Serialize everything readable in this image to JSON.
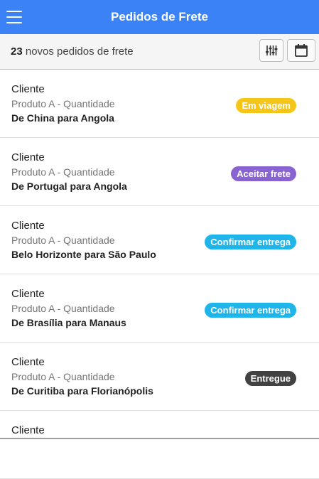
{
  "header": {
    "title": "Pedidos de Frete",
    "menu_icon": "hamburger-menu-icon"
  },
  "subheader": {
    "count": "23",
    "count_suffix": " novos pedidos de frete",
    "filter_icon": "sliders-icon",
    "calendar_icon": "calendar-icon"
  },
  "orders": [
    {
      "client": "Cliente",
      "product": "Produto A - Quantidade",
      "route": "De China para Angola",
      "status": "Em viagem",
      "status_color": "#f5c518"
    },
    {
      "client": "Cliente",
      "product": "Produto A - Quantidade",
      "route": "De Portugal para Angola",
      "status": "Aceitar frete",
      "status_color": "#8a63d2"
    },
    {
      "client": "Cliente",
      "product": "Produto A - Quantidade",
      "route": "Belo Horizonte para São Paulo",
      "status": "Confirmar entrega",
      "status_color": "#1fb4ea"
    },
    {
      "client": "Cliente",
      "product": "Produto A - Quantidade",
      "route": "De Brasília para Manaus",
      "status": "Confirmar entrega",
      "status_color": "#1fb4ea"
    },
    {
      "client": "Cliente",
      "product": "Produto A - Quantidade",
      "route": "De Curitiba para Florianópolis",
      "status": "Entregue",
      "status_color": "#424242"
    },
    {
      "client": "Cliente"
    }
  ]
}
